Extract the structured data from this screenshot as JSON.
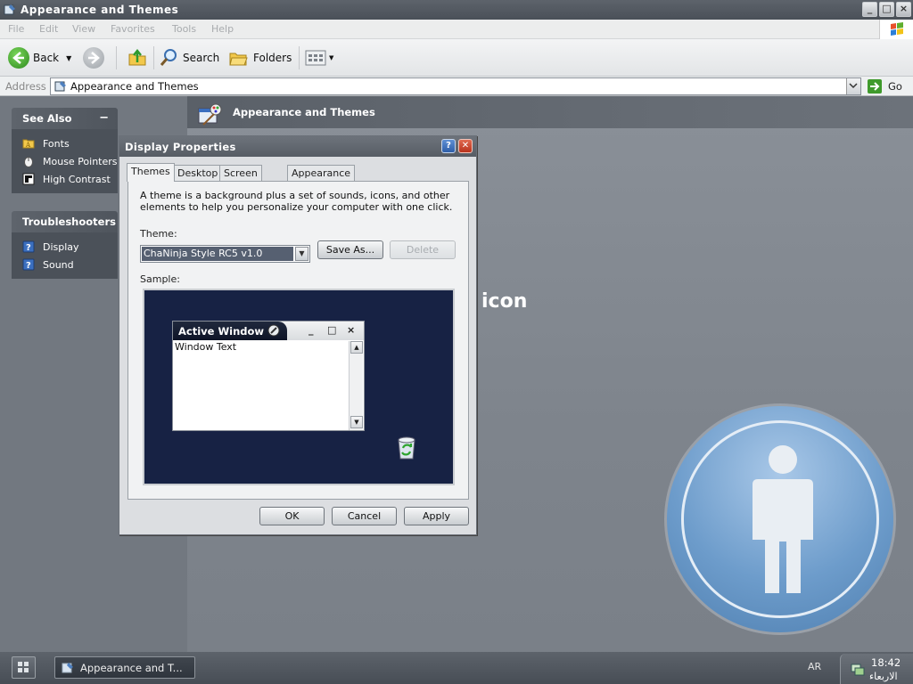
{
  "window": {
    "title": "Appearance and Themes"
  },
  "menubar": {
    "items": [
      "File",
      "Edit",
      "View",
      "Favorites",
      "Tools",
      "Help"
    ]
  },
  "toolbar": {
    "back_label": "Back",
    "search_label": "Search",
    "folders_label": "Folders"
  },
  "address": {
    "label": "Address",
    "value": "Appearance and Themes",
    "go_label": "Go"
  },
  "see_also": {
    "title": "See Also",
    "items": [
      "Fonts",
      "Mouse Pointers",
      "High Contrast"
    ]
  },
  "troubleshooters": {
    "title": "Troubleshooters",
    "items": [
      "Display",
      "Sound"
    ]
  },
  "main": {
    "banner_title": "Appearance and Themes",
    "partial_text": "icon"
  },
  "dialog": {
    "title": "Display Properties",
    "tabs": [
      "Themes",
      "Desktop",
      "Screen Saver",
      "Appearance"
    ],
    "description": "A theme is a background plus a set of sounds, icons, and other elements to help you personalize your computer with one click.",
    "theme_label": "Theme:",
    "theme_value": "ChaNinja Style RC5 v1.0",
    "save_as_label": "Save As...",
    "delete_label": "Delete",
    "sample_label": "Sample:",
    "sample_window_title": "Active Window",
    "sample_window_text": "Window Text",
    "ok_label": "OK",
    "cancel_label": "Cancel",
    "apply_label": "Apply"
  },
  "taskbar": {
    "task_label": "Appearance and T...",
    "language": "AR",
    "time": "18:42",
    "day": "الاربعاء"
  }
}
